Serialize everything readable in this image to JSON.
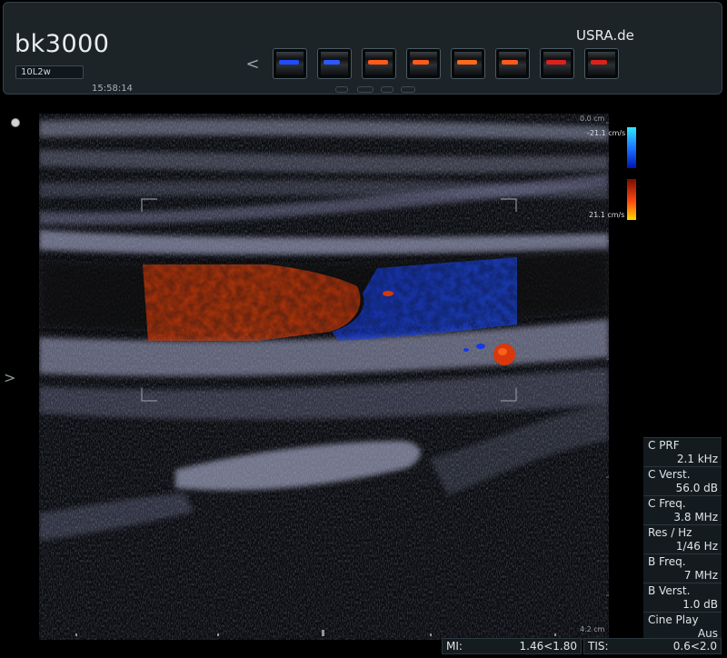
{
  "header": {
    "logo": "bk3000",
    "probe": "10L2w",
    "time": "15:58:14",
    "brand": "USRA.de",
    "prev_icon": "chevron-left-icon",
    "prev_label": "<",
    "thumbnails": [
      {
        "flow_color": "#1f4cff"
      },
      {
        "flow_color": "#2a59ff"
      },
      {
        "flow_color": "#ff5a1a"
      },
      {
        "flow_color": "#ff5a1a"
      },
      {
        "flow_color": "#ff6a1a"
      },
      {
        "flow_color": "#ff5a1a"
      },
      {
        "flow_color": "#e0201a"
      },
      {
        "flow_color": "#e0201a"
      }
    ]
  },
  "image": {
    "depth_top": "0.0 cm",
    "depth_bottom": "4.2 cm",
    "color_scale": {
      "top_label": "-21.1 cm/s",
      "bottom_label": "21.1 cm/s",
      "negative_color": "#1a6cff",
      "positive_color": "#ff4a10"
    },
    "side_arrow": ">"
  },
  "params": [
    {
      "label": "C PRF",
      "value": "2.1 kHz"
    },
    {
      "label": "C Verst.",
      "value": "56.0 dB"
    },
    {
      "label": "C Freq.",
      "value": "3.8 MHz"
    },
    {
      "label": "Res / Hz",
      "value": "1/46 Hz"
    },
    {
      "label": "B Freq.",
      "value": "7 MHz"
    },
    {
      "label": "B Verst.",
      "value": "1.0 dB"
    },
    {
      "label": "Cine Play",
      "value": "Aus"
    }
  ],
  "indices": {
    "mi_label": "MI:",
    "mi_value": "1.46<1.80",
    "tis_label": "TIS:",
    "tis_value": "0.6<2.0"
  }
}
